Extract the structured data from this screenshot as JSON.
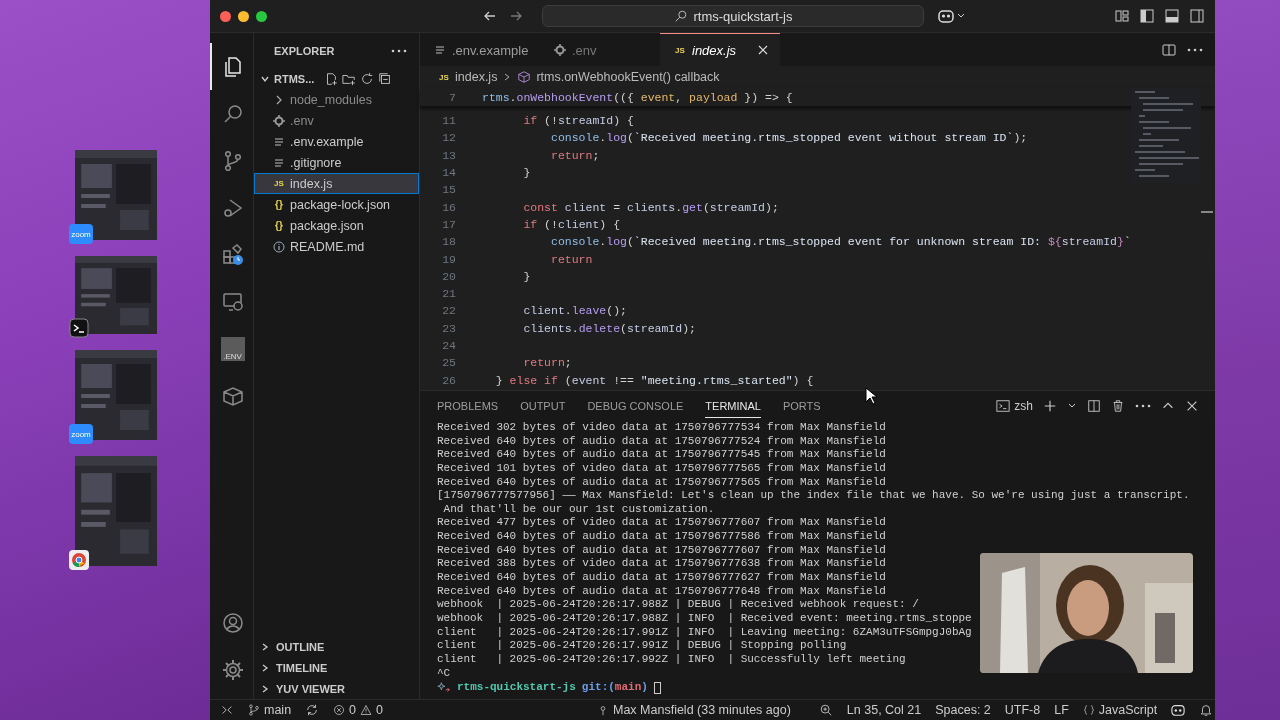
{
  "desktop": {
    "thumbnails": [
      {
        "kind": "zoom",
        "badge_text": "zoom"
      },
      {
        "kind": "terminal"
      },
      {
        "kind": "zoom",
        "badge_text": "zoom"
      },
      {
        "kind": "chrome"
      }
    ]
  },
  "title_bar": {
    "search": "rtms-quickstart-js"
  },
  "activity_bar": {
    "items": [
      {
        "kind": "files",
        "selected": true
      },
      {
        "kind": "search",
        "selected": false
      },
      {
        "kind": "source-control",
        "selected": false
      },
      {
        "kind": "run-debug",
        "selected": false
      },
      {
        "kind": "extensions",
        "selected": false
      },
      {
        "kind": "remote",
        "selected": false
      },
      {
        "kind": "env",
        "label": ".ENV",
        "selected": false
      },
      {
        "kind": "box",
        "selected": false
      }
    ],
    "bottom": [
      {
        "kind": "account"
      },
      {
        "kind": "settings"
      }
    ]
  },
  "sidebar": {
    "title": "EXPLORER",
    "project": {
      "name": "RTMS...",
      "expanded": true
    },
    "files": [
      {
        "name": "node_modules",
        "kind": "folder",
        "dimmed": true,
        "selected": false
      },
      {
        "name": ".env",
        "kind": "gear",
        "dimmed": true,
        "selected": false
      },
      {
        "name": ".env.example",
        "kind": "lines",
        "dimmed": false,
        "selected": false
      },
      {
        "name": ".gitignore",
        "kind": "lines",
        "dimmed": false,
        "selected": false
      },
      {
        "name": "index.js",
        "kind": "js",
        "icon_text": "JS",
        "dimmed": false,
        "selected": true
      },
      {
        "name": "package-lock.json",
        "kind": "json",
        "icon_text": "{}",
        "dimmed": false,
        "selected": false
      },
      {
        "name": "package.json",
        "kind": "json",
        "icon_text": "{}",
        "dimmed": false,
        "selected": false
      },
      {
        "name": "README.md",
        "kind": "info",
        "dimmed": false,
        "selected": false
      }
    ],
    "sections": [
      {
        "label": "OUTLINE",
        "expanded": false
      },
      {
        "label": "TIMELINE",
        "expanded": false
      },
      {
        "label": "YUV VIEWER",
        "expanded": false
      }
    ]
  },
  "editor": {
    "tabs": [
      {
        "label": ".env.example",
        "kind": "lines",
        "selected": false,
        "preview": false,
        "dimmed": false
      },
      {
        "label": ".env",
        "kind": "gear",
        "selected": false,
        "preview": false,
        "dimmed": true
      },
      {
        "label": "index.js",
        "kind": "js",
        "icon_text": "JS",
        "selected": true,
        "preview": true,
        "dimmed": false
      }
    ],
    "breadcrumb": {
      "icon_text": "JS",
      "file": "index.js",
      "symbol": "rtms.onWebhookEvent() callback"
    },
    "sticky_line": {
      "number": "7",
      "tokens": [
        {
          "text": "rtms",
          "kind": "obj"
        },
        {
          "text": ".",
          "kind": "punc"
        },
        {
          "text": "onWebhookEvent",
          "kind": "fn"
        },
        {
          "text": "(({ ",
          "kind": "punc"
        },
        {
          "text": "event",
          "kind": "param"
        },
        {
          "text": ", ",
          "kind": "punc"
        },
        {
          "text": "payload",
          "kind": "param"
        },
        {
          "text": " }) => {",
          "kind": "punc"
        }
      ]
    },
    "lines": [
      {
        "number": "11",
        "tokens": [
          {
            "text": "      if",
            "kind": "kw"
          },
          {
            "text": " (!",
            "kind": "punc"
          },
          {
            "text": "streamId",
            "kind": "var"
          },
          {
            "text": ") {",
            "kind": "punc"
          }
        ]
      },
      {
        "number": "12",
        "tokens": [
          {
            "text": "          console",
            "kind": "obj"
          },
          {
            "text": ".",
            "kind": "punc"
          },
          {
            "text": "log",
            "kind": "fn"
          },
          {
            "text": "(",
            "kind": "punc"
          },
          {
            "text": "`Received meeting.rtms_stopped event without stream ID`",
            "kind": "str"
          },
          {
            "text": ");",
            "kind": "punc"
          }
        ]
      },
      {
        "number": "13",
        "tokens": [
          {
            "text": "          return",
            "kind": "kw"
          },
          {
            "text": ";",
            "kind": "punc"
          }
        ]
      },
      {
        "number": "14",
        "tokens": [
          {
            "text": "      }",
            "kind": "punc"
          }
        ]
      },
      {
        "number": "15"
      },
      {
        "number": "16",
        "tokens": [
          {
            "text": "      const",
            "kind": "kw"
          },
          {
            "text": " client",
            "kind": "var"
          },
          {
            "text": " = ",
            "kind": "punc"
          },
          {
            "text": "clients",
            "kind": "var"
          },
          {
            "text": ".",
            "kind": "punc"
          },
          {
            "text": "get",
            "kind": "fn"
          },
          {
            "text": "(",
            "kind": "punc"
          },
          {
            "text": "streamId",
            "kind": "var"
          },
          {
            "text": ");",
            "kind": "punc"
          }
        ]
      },
      {
        "number": "17",
        "tokens": [
          {
            "text": "      if",
            "kind": "kw"
          },
          {
            "text": " (!",
            "kind": "punc"
          },
          {
            "text": "client",
            "kind": "var"
          },
          {
            "text": ") {",
            "kind": "punc"
          }
        ]
      },
      {
        "number": "18",
        "tokens": [
          {
            "text": "          console",
            "kind": "obj"
          },
          {
            "text": ".",
            "kind": "punc"
          },
          {
            "text": "log",
            "kind": "fn"
          },
          {
            "text": "(",
            "kind": "punc"
          },
          {
            "text": "`Received meeting.rtms_stopped event for unknown stream ID: ",
            "kind": "str"
          },
          {
            "text": "${",
            "kind": "tpl"
          },
          {
            "text": "streamId",
            "kind": "var"
          },
          {
            "text": "}",
            "kind": "tpl"
          },
          {
            "text": "`",
            "kind": "str"
          }
        ]
      },
      {
        "number": "19",
        "tokens": [
          {
            "text": "          return",
            "kind": "kw"
          }
        ]
      },
      {
        "number": "20",
        "tokens": [
          {
            "text": "      }",
            "kind": "punc"
          }
        ]
      },
      {
        "number": "21"
      },
      {
        "number": "22",
        "tokens": [
          {
            "text": "      client",
            "kind": "var"
          },
          {
            "text": ".",
            "kind": "punc"
          },
          {
            "text": "leave",
            "kind": "fn"
          },
          {
            "text": "();",
            "kind": "punc"
          }
        ]
      },
      {
        "number": "23",
        "tokens": [
          {
            "text": "      clients",
            "kind": "var"
          },
          {
            "text": ".",
            "kind": "punc"
          },
          {
            "text": "delete",
            "kind": "fn"
          },
          {
            "text": "(",
            "kind": "punc"
          },
          {
            "text": "streamId",
            "kind": "var"
          },
          {
            "text": ");",
            "kind": "punc"
          }
        ]
      },
      {
        "number": "24"
      },
      {
        "number": "25",
        "tokens": [
          {
            "text": "      return",
            "kind": "kw"
          },
          {
            "text": ";",
            "kind": "punc"
          }
        ]
      },
      {
        "number": "26",
        "tokens": [
          {
            "text": "  } ",
            "kind": "punc"
          },
          {
            "text": "else if",
            "kind": "kw"
          },
          {
            "text": " (",
            "kind": "punc"
          },
          {
            "text": "event",
            "kind": "var"
          },
          {
            "text": " !== ",
            "kind": "punc"
          },
          {
            "text": "\"meeting.rtms_started\"",
            "kind": "str"
          },
          {
            "text": ") {",
            "kind": "punc"
          }
        ]
      }
    ]
  },
  "panel": {
    "tabs": [
      {
        "label": "PROBLEMS",
        "selected": false
      },
      {
        "label": "OUTPUT",
        "selected": false
      },
      {
        "label": "DEBUG CONSOLE",
        "selected": false
      },
      {
        "label": "TERMINAL",
        "selected": true
      },
      {
        "label": "PORTS",
        "selected": false
      }
    ],
    "shell": "zsh",
    "lines": [
      "Received 302 bytes of video data at 1750796777534 from Max Mansfield",
      "Received 640 bytes of audio data at 1750796777524 from Max Mansfield",
      "Received 640 bytes of audio data at 1750796777545 from Max Mansfield",
      "Received 101 bytes of video data at 1750796777565 from Max Mansfield",
      "Received 640 bytes of audio data at 1750796777565 from Max Mansfield",
      "[1750796777577956] —— Max Mansfield: Let's clean up the index file that we have. So we're using just a transcript.",
      " And that'll be our our 1st customization.",
      "Received 477 bytes of video data at 1750796777607 from Max Mansfield",
      "Received 640 bytes of audio data at 1750796777586 from Max Mansfield",
      "Received 640 bytes of audio data at 1750796777607 from Max Mansfield",
      "Received 388 bytes of video data at 1750796777638 from Max Mansfield",
      "Received 640 bytes of audio data at 1750796777627 from Max Mansfield",
      "Received 640 bytes of audio data at 1750796777648 from Max Mansfield",
      "webhook  | 2025-06-24T20:26:17.988Z | DEBUG | Received webhook request: /",
      "webhook  | 2025-06-24T20:26:17.988Z | INFO  | Received event: meeting.rtms_stoppe",
      "client   | 2025-06-24T20:26:17.991Z | INFO  | Leaving meeting: 6ZAM3uTFSGmpgJ0bAg",
      "client   | 2025-06-24T20:26:17.991Z | DEBUG | Stopping polling",
      "client   | 2025-06-24T20:26:17.992Z | INFO  | Successfully left meeting",
      "^C"
    ],
    "prompt": {
      "dir": "rtms-quickstart-js",
      "git_open": "git:(",
      "branch": "main",
      "git_close": ")"
    }
  },
  "status_bar": {
    "branch": "main",
    "errors": "0",
    "warnings": "0",
    "blame": "Max Mansfield (33 minutes ago)",
    "position": "Ln 35, Col 21",
    "spaces": "Spaces: 2",
    "encoding": "UTF-8",
    "eol": "LF",
    "language": "JavaScript"
  }
}
